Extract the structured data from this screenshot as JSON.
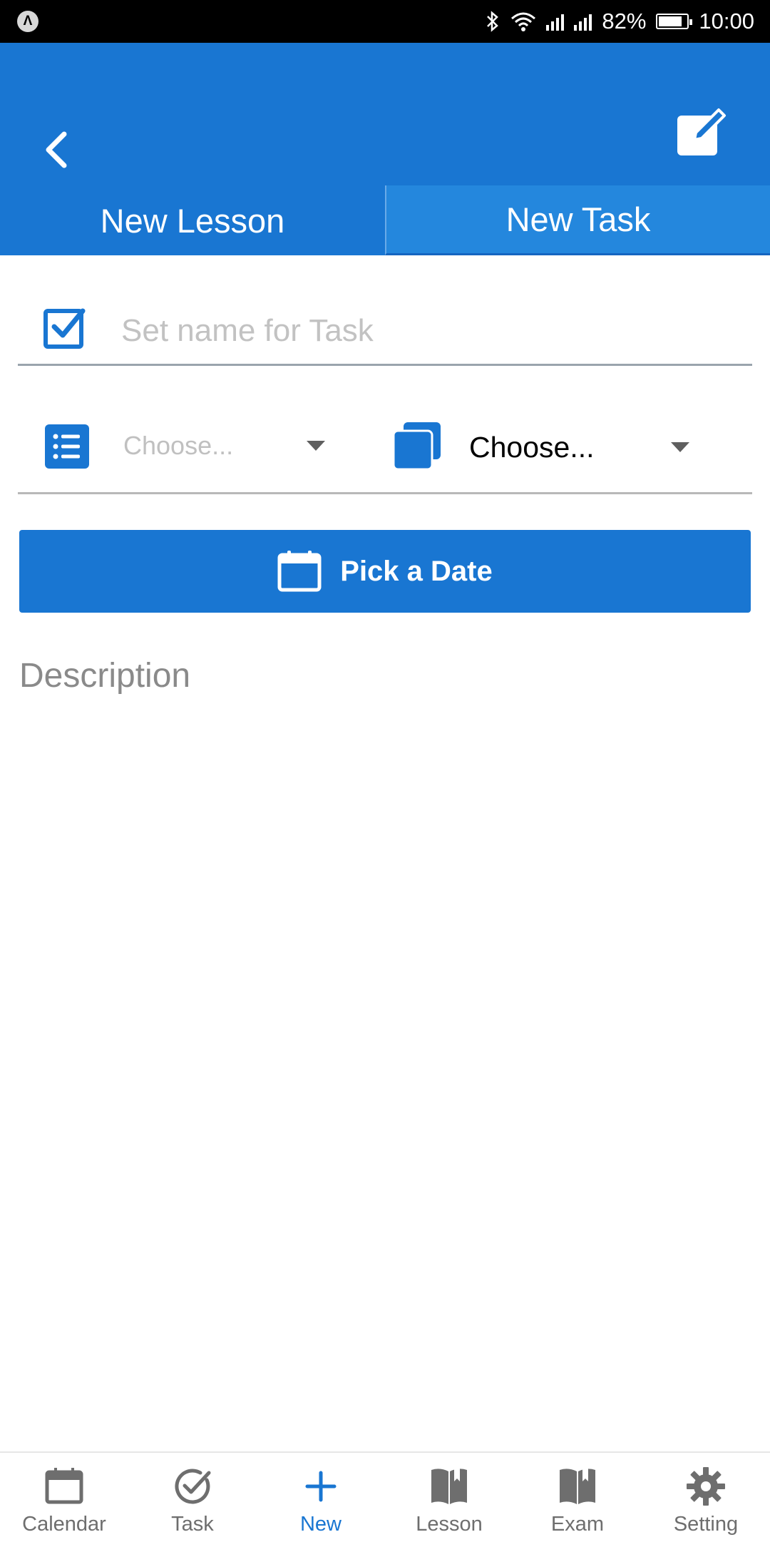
{
  "status_bar": {
    "battery": "82%",
    "battery_level": 0.82,
    "time": "10:00"
  },
  "header": {
    "tabs": [
      {
        "label": "New Lesson",
        "active": false
      },
      {
        "label": "New Task",
        "active": true
      }
    ]
  },
  "form": {
    "name_placeholder": "Set name for Task",
    "select_one": "Choose...",
    "select_two": "Choose...",
    "pick_date_label": "Pick a Date",
    "description_placeholder": "Description"
  },
  "bottom_nav": [
    {
      "label": "Calendar",
      "icon": "calendar-icon",
      "active": false
    },
    {
      "label": "Task",
      "icon": "check-circle-icon",
      "active": false
    },
    {
      "label": "New",
      "icon": "plus-icon",
      "active": true
    },
    {
      "label": "Lesson",
      "icon": "book-icon",
      "active": false
    },
    {
      "label": "Exam",
      "icon": "book-icon",
      "active": false
    },
    {
      "label": "Setting",
      "icon": "gear-icon",
      "active": false
    }
  ],
  "colors": {
    "primary": "#1976d2",
    "active_tab": "#2487dd",
    "inactive_nav": "#6e6e6e"
  }
}
